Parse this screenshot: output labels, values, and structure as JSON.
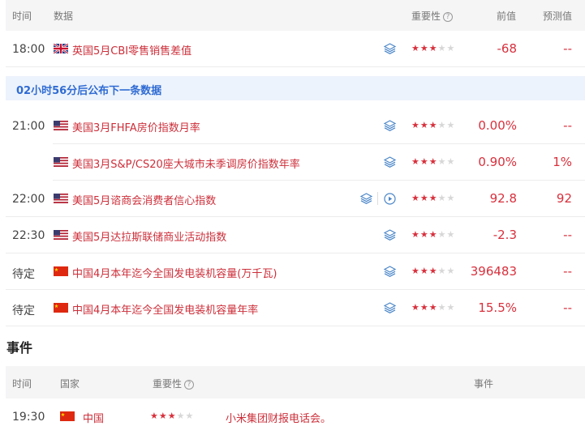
{
  "header": {
    "time": "时间",
    "data": "数据",
    "importance": "重要性",
    "help_glyph": "?",
    "previous": "前值",
    "forecast": "预测值"
  },
  "rows": [
    {
      "time": "18:00",
      "flag": "uk",
      "name": "英国5月CBI零售销售差值",
      "stars": 3,
      "previous": "-68",
      "forecast": "--",
      "has_video": false
    },
    {
      "time": "21:00",
      "flag": "us",
      "name": "美国3月FHFA房价指数月率",
      "stars": 3,
      "previous": "0.00%",
      "forecast": "--",
      "has_video": false
    },
    {
      "time": "",
      "flag": "us",
      "name": "美国3月S&P/CS20座大城市未季调房价指数年率",
      "stars": 3,
      "previous": "0.90%",
      "forecast": "1%",
      "has_video": false
    },
    {
      "time": "22:00",
      "flag": "us",
      "name": "美国5月谘商会消费者信心指数",
      "stars": 3,
      "previous": "92.8",
      "forecast": "92",
      "has_video": true
    },
    {
      "time": "22:30",
      "flag": "us",
      "name": "美国5月达拉斯联储商业活动指数",
      "stars": 3,
      "previous": "-2.3",
      "forecast": "--",
      "has_video": false
    },
    {
      "time": "待定",
      "flag": "cn",
      "name": "中国4月本年迄今全国发电装机容量(万千瓦)",
      "stars": 3,
      "previous": "396483",
      "forecast": "--",
      "has_video": false
    },
    {
      "time": "待定",
      "flag": "cn",
      "name": "中国4月本年迄今全国发电装机容量年率",
      "stars": 3,
      "previous": "15.5%",
      "forecast": "--",
      "has_video": false
    }
  ],
  "banner": {
    "text": "02小时56分后公布下一条数据"
  },
  "events": {
    "title": "事件",
    "header": {
      "time": "时间",
      "country": "国家",
      "importance": "重要性",
      "help_glyph": "?",
      "event": "事件"
    },
    "rows": [
      {
        "time": "19:30",
        "flag": "cn",
        "country": "中国",
        "stars": 3,
        "event": "小米集团财报电话会。"
      }
    ]
  },
  "colors": {
    "accent_red": "#d8303c",
    "banner_blue": "#2f6bd3",
    "banner_bg": "#edf3fc",
    "header_bg": "#f5f5f6"
  },
  "icons": {
    "layers": "layers-icon",
    "play": "play-circle-icon",
    "help": "question-circle-icon"
  }
}
